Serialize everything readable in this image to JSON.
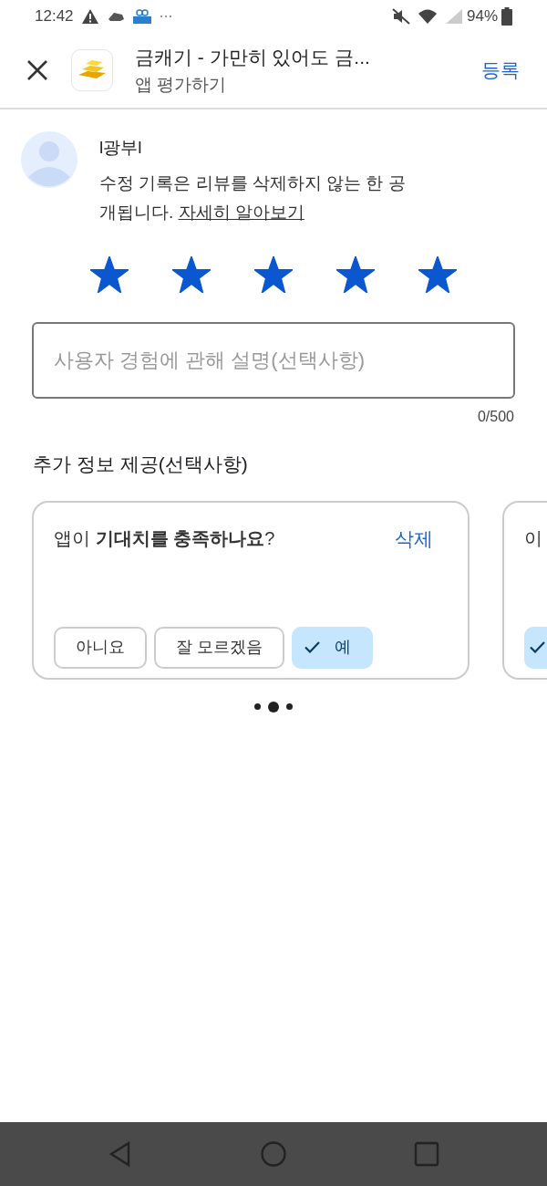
{
  "status_bar": {
    "time": "12:42",
    "battery": "94%"
  },
  "header": {
    "title": "금캐기 - 가만히 있어도 금...",
    "subtitle": "앱 평가하기",
    "action": "등록"
  },
  "user": {
    "name": "l광부l",
    "notice": "수정 기록은 리뷰를 삭제하지 않는 한 공개됩니다.",
    "link": "자세히 알아보기"
  },
  "rating": {
    "stars": 5
  },
  "review_field": {
    "placeholder": "사용자 경험에 관해 설명(선택사항)",
    "counter": "0/500"
  },
  "extra_section": {
    "title": "추가 정보 제공(선택사항)"
  },
  "question_cards": [
    {
      "question": "앱이 **기대치를 충족하나요**?",
      "delete": "삭제",
      "options": [
        {
          "label": "아니요",
          "selected": false
        },
        {
          "label": "잘 모르겠음",
          "selected": false
        },
        {
          "label": "예",
          "selected": true
        }
      ]
    },
    {
      "question": "이",
      "options": [
        {
          "selected": true
        }
      ]
    }
  ],
  "pager": [
    {
      "selected": false
    },
    {
      "selected": true
    },
    {
      "selected": false
    }
  ]
}
